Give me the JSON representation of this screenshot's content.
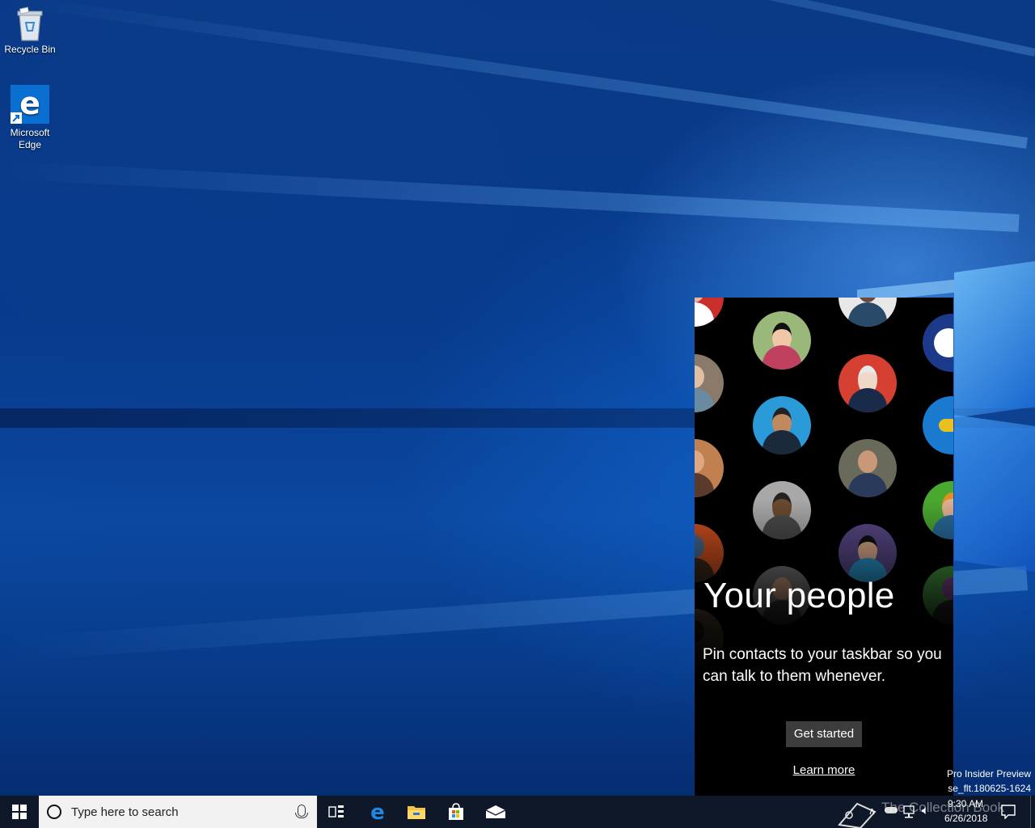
{
  "desktop": {
    "icons": [
      {
        "label": "Recycle Bin",
        "icon": "recycle-bin-icon"
      },
      {
        "label_line1": "Microsoft",
        "label_line2": "Edge",
        "icon": "edge-icon"
      }
    ]
  },
  "people_flyout": {
    "title": "Your people",
    "description": "Pin contacts to your taskbar so you can talk to them whenever.",
    "get_started": "Get started",
    "learn_more": "Learn more"
  },
  "watermark": {
    "line1": "Pro Insider Preview",
    "line2": "se_flt.180625-1624",
    "overlay": "The Collection Book"
  },
  "taskbar": {
    "search_placeholder": "Type here to search",
    "pinned": [
      "task-view-icon",
      "edge-icon",
      "file-explorer-icon",
      "store-icon",
      "mail-icon"
    ],
    "clock_time": "9:30 AM",
    "clock_date": "6/26/2018"
  },
  "colors": {
    "accent": "#0078d7",
    "taskbar": "#10162e",
    "flyout_bg": "#000000",
    "button_bg": "#3c3c3c"
  }
}
